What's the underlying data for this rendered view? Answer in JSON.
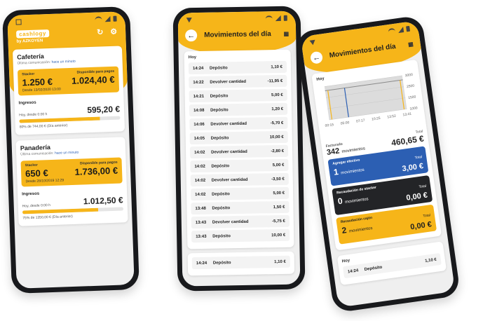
{
  "phone1": {
    "logo": "cashlogy",
    "brand": "by AZKOYEN",
    "cards": [
      {
        "title": "Cafetería",
        "last_comm": "Última comunicación:",
        "last_comm_link": "hace un minuto",
        "stacker_label": "Stacker",
        "stacker_value": "1.250 €",
        "stacker_date": "Desde 13/02/2020 13:00",
        "disp_label": "Disponible para pagos",
        "disp_value": "1.024,40 €",
        "ingresos_label": "Ingresos",
        "ingresos_since": "Hoy, desde 0:00 h",
        "ingresos_value": "595,20 €",
        "bar_fraction": 0.8,
        "compare": "80% de 744,00 € (Día anterior)"
      },
      {
        "title": "Panadería",
        "last_comm": "Última comunicación:",
        "last_comm_link": "hace un minuto",
        "stacker_label": "Stacker",
        "stacker_value": "650 €",
        "stacker_date": "Desde 28/10/2019 12:29",
        "disp_label": "Disponible para pagos",
        "disp_value": "1.736,00 €",
        "ingresos_label": "Ingresos",
        "ingresos_since": "Hoy, desde 0:00 h",
        "ingresos_value": "1.012,50 €",
        "bar_fraction": 0.75,
        "compare": "75% de 1350,00 € (Día anterior)"
      }
    ]
  },
  "phone2": {
    "title": "Movimientos del día",
    "section": "Hoy",
    "movements": [
      {
        "time": "14:24",
        "desc": "Depósito",
        "amount": "1,10 €"
      },
      {
        "time": "14:22",
        "desc": "Devolver cantidad",
        "amount": "-11,95 €"
      },
      {
        "time": "14:21",
        "desc": "Depósito",
        "amount": "5,00 €"
      },
      {
        "time": "14:08",
        "desc": "Depósito",
        "amount": "1,20 €"
      },
      {
        "time": "14:06",
        "desc": "Devolver cantidad",
        "amount": "-5,70 €"
      },
      {
        "time": "14:05",
        "desc": "Depósito",
        "amount": "10,00 €"
      },
      {
        "time": "14:02",
        "desc": "Devolver cantidad",
        "amount": "-2,80 €"
      },
      {
        "time": "14:02",
        "desc": "Depósito",
        "amount": "5,00 €"
      },
      {
        "time": "14:02",
        "desc": "Devolver cantidad",
        "amount": "-3,50 €"
      },
      {
        "time": "14:02",
        "desc": "Depósito",
        "amount": "5,00 €"
      },
      {
        "time": "13:48",
        "desc": "Depósito",
        "amount": "1,50 €"
      },
      {
        "time": "13:43",
        "desc": "Devolver cantidad",
        "amount": "-5,75 €"
      },
      {
        "time": "13:43",
        "desc": "Depósito",
        "amount": "10,00 €"
      }
    ],
    "extra": {
      "time": "14:24",
      "desc": "Depósito",
      "amount": "1,10 €"
    }
  },
  "phone3": {
    "title": "Movimientos del día",
    "section": "Hoy",
    "chart_data": {
      "type": "line",
      "x": [
        "00:15",
        "05:00",
        "07:17",
        "10:25",
        "13:52",
        "13:41"
      ],
      "y_ticks": [
        "3000",
        "2500",
        "1500",
        "1000"
      ]
    },
    "facturado_label": "Facturado",
    "facturado_count": "342",
    "facturado_unit": "movimientos",
    "total_label": "Total",
    "facturado_total": "460,65 €",
    "blocks": [
      {
        "label": "Agregar efectivo",
        "count": "1",
        "unit": "movimientos",
        "total_label": "Total",
        "value": "3,00 €"
      },
      {
        "label": "Recaudación de stacker",
        "count": "0",
        "unit": "movimientos",
        "total_label": "Total",
        "value": "0,00 €"
      },
      {
        "label": "Recaudación cajón",
        "count": "2",
        "unit": "movimientos",
        "total_label": "Total",
        "value": "0,00 €"
      }
    ],
    "section2": "Hoy",
    "mov2": {
      "time": "14:24",
      "desc": "Depósito",
      "amount": "1,10 €"
    }
  }
}
